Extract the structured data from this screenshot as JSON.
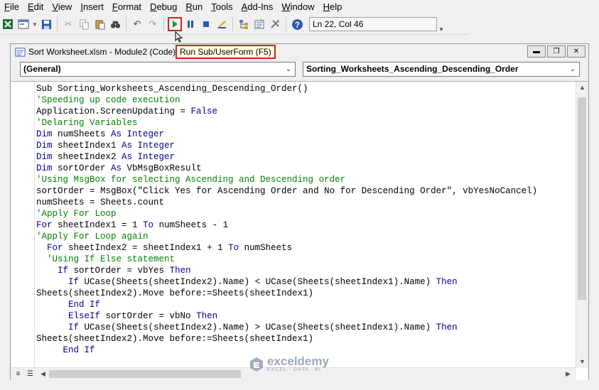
{
  "menu": [
    "File",
    "Edit",
    "View",
    "Insert",
    "Format",
    "Debug",
    "Run",
    "Tools",
    "Add-Ins",
    "Window",
    "Help"
  ],
  "toolbar": {
    "icons": [
      "excel-icon",
      "insert-userform-icon",
      "dropdown-icon",
      "save-icon",
      "cut-icon",
      "copy-icon",
      "paste-icon",
      "find-icon",
      "undo-icon",
      "redo-icon",
      "run-icon",
      "break-icon",
      "reset-icon",
      "design-mode-icon",
      "project-explorer-icon",
      "properties-icon",
      "toolbox-icon",
      "help-icon"
    ],
    "status": "Ln 22, Col 46"
  },
  "window": {
    "title": "Sort Worksheet.xlsm - Module2 (Code)",
    "tooltip": "Run Sub/UserForm (F5)",
    "object_combo": "(General)",
    "proc_combo": "Sorting_Worksheets_Ascending_Descending_Order"
  },
  "code_lines": [
    [
      [
        "n",
        "Sub Sorting_Worksheets_Ascending_Descending_Order()"
      ]
    ],
    [
      [
        "c",
        "'Speeding up code execution"
      ]
    ],
    [
      [
        "n",
        "Application.ScreenUpdating = "
      ],
      [
        "k",
        "False"
      ]
    ],
    [
      [
        "c",
        "'Delaring Variables"
      ]
    ],
    [
      [
        "k",
        "Dim"
      ],
      [
        "n",
        " numSheets "
      ],
      [
        "k",
        "As Integer"
      ]
    ],
    [
      [
        "k",
        "Dim"
      ],
      [
        "n",
        " sheetIndex1 "
      ],
      [
        "k",
        "As Integer"
      ]
    ],
    [
      [
        "k",
        "Dim"
      ],
      [
        "n",
        " sheetIndex2 "
      ],
      [
        "k",
        "As Integer"
      ]
    ],
    [
      [
        "k",
        "Dim"
      ],
      [
        "n",
        " sortOrder "
      ],
      [
        "k",
        "As"
      ],
      [
        "n",
        " VbMsgBoxResult"
      ]
    ],
    [
      [
        "c",
        "'Using MsgBox for selecting Ascending and Descending order"
      ]
    ],
    [
      [
        "n",
        "sortOrder = MsgBox(\"Click Yes for Ascending Order and No for Descending Order\", vbYesNoCancel)"
      ]
    ],
    [
      [
        "n",
        "numSheets = Sheets.count"
      ]
    ],
    [
      [
        "c",
        "'Apply For Loop"
      ]
    ],
    [
      [
        "k",
        "For"
      ],
      [
        "n",
        " sheetIndex1 = 1 "
      ],
      [
        "k",
        "To"
      ],
      [
        "n",
        " numSheets - 1"
      ]
    ],
    [
      [
        "c",
        "'Apply For Loop again"
      ]
    ],
    [
      [
        "n",
        "  "
      ],
      [
        "k",
        "For"
      ],
      [
        "n",
        " sheetIndex2 = sheetIndex1 + 1 "
      ],
      [
        "k",
        "To"
      ],
      [
        "n",
        " numSheets"
      ]
    ],
    [
      [
        "n",
        "  "
      ],
      [
        "c",
        "'Using If Else statement"
      ]
    ],
    [
      [
        "n",
        "    "
      ],
      [
        "k",
        "If"
      ],
      [
        "n",
        " sortOrder = vbYes "
      ],
      [
        "k",
        "Then"
      ]
    ],
    [
      [
        "n",
        "      "
      ],
      [
        "k",
        "If"
      ],
      [
        "n",
        " UCase(Sheets(sheetIndex2).Name) < UCase(Sheets(sheetIndex1).Name) "
      ],
      [
        "k",
        "Then"
      ]
    ],
    [
      [
        "n",
        "Sheets(sheetIndex2).Move before:=Sheets(sheetIndex1)"
      ]
    ],
    [
      [
        "n",
        "      "
      ],
      [
        "k",
        "End If"
      ]
    ],
    [
      [
        "n",
        "      "
      ],
      [
        "k",
        "ElseIf"
      ],
      [
        "n",
        " sortOrder = vbNo "
      ],
      [
        "k",
        "Then"
      ]
    ],
    [
      [
        "n",
        "      "
      ],
      [
        "k",
        "If"
      ],
      [
        "n",
        " UCase(Sheets(sheetIndex2).Name) > UCase(Sheets(sheetIndex1).Name) "
      ],
      [
        "k",
        "Then"
      ]
    ],
    [
      [
        "n",
        "Sheets(sheetIndex2).Move before:=Sheets(sheetIndex1)"
      ]
    ],
    [
      [
        "n",
        "     "
      ],
      [
        "k",
        "End If"
      ]
    ]
  ],
  "watermark": {
    "name": "exceldemy",
    "tagline": "EXCEL · DATA · BI"
  },
  "colors": {
    "keyword": "#00008b",
    "comment": "#008000",
    "highlight": "#d0202a",
    "tooltip_bg": "#ffffe1"
  }
}
